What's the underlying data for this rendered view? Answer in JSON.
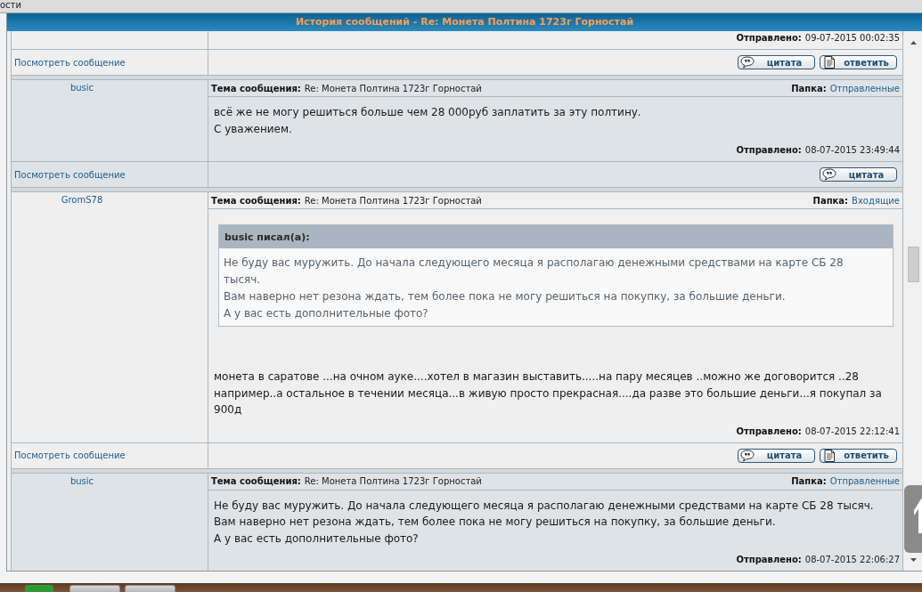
{
  "top_strip": {
    "text": "ости"
  },
  "window": {
    "title": "История сообщений - Re: Монета Полтина 1723г Горностай"
  },
  "messages": [
    {
      "sent_label": "Отправлено:",
      "sent": "09-07-2015 00:02:35",
      "view_link": "Посмотреть сообщение",
      "buttons": [
        {
          "kind": "quote",
          "label": "цитата"
        },
        {
          "kind": "reply",
          "label": "ответить"
        }
      ]
    },
    {
      "author": "busic",
      "subject_label": "Тема сообщения:",
      "subject": "Re: Монета Полтина 1723г Горностай",
      "folder_label": "Папка:",
      "folder": "Отправленные",
      "text": [
        "всё же не могу решиться больше чем 28 000руб заплатить за эту полтину.",
        "С уважением."
      ],
      "sent_label": "Отправлено:",
      "sent": "08-07-2015 23:49:44",
      "view_link": "Посмотреть сообщение",
      "buttons": [
        {
          "kind": "quote",
          "label": "цитата"
        }
      ]
    },
    {
      "author": "GromS78",
      "subject_label": "Тема сообщения:",
      "subject": "Re: Монета Полтина 1723г Горностай",
      "folder_label": "Папка:",
      "folder": "Входящие",
      "quote": {
        "header": "busic писал(а):",
        "text": [
          "Не буду вас муружить. До начала следующего месяца я располагаю денежными средствами на карте СБ 28 тысяч.",
          "Вам наверно нет резона ждать, тем более пока не могу решиться на покупку, за большие деньги.",
          "А у вас есть дополнительные фото?"
        ]
      },
      "text": [
        "монета в саратове ...на очном ауке....хотел в магазин выставить.....на пару месяцев ..можно же договорится ..28 например..а остальное в течении месяца...в живую просто прекрасная....да разве это большие деньги...я покупал за 900д"
      ],
      "sent_label": "Отправлено:",
      "sent": "08-07-2015 22:12:41",
      "view_link": "Посмотреть сообщение",
      "buttons": [
        {
          "kind": "quote",
          "label": "цитата"
        },
        {
          "kind": "reply",
          "label": "ответить"
        }
      ]
    },
    {
      "author": "busic",
      "subject_label": "Тема сообщения:",
      "subject": "Re: Монета Полтина 1723г Горностай",
      "folder_label": "Папка:",
      "folder": "Отправленные",
      "text": [
        "Не буду вас муружить. До начала следующего месяца я располагаю денежными средствами на карте СБ 28 тысяч.",
        "Вам наверно нет резона ждать, тем более пока не могу решиться на покупку, за большие деньги.",
        "А у вас есть дополнительные фото?"
      ],
      "sent_label": "Отправлено:",
      "sent": "08-07-2015 22:06:27"
    }
  ]
}
